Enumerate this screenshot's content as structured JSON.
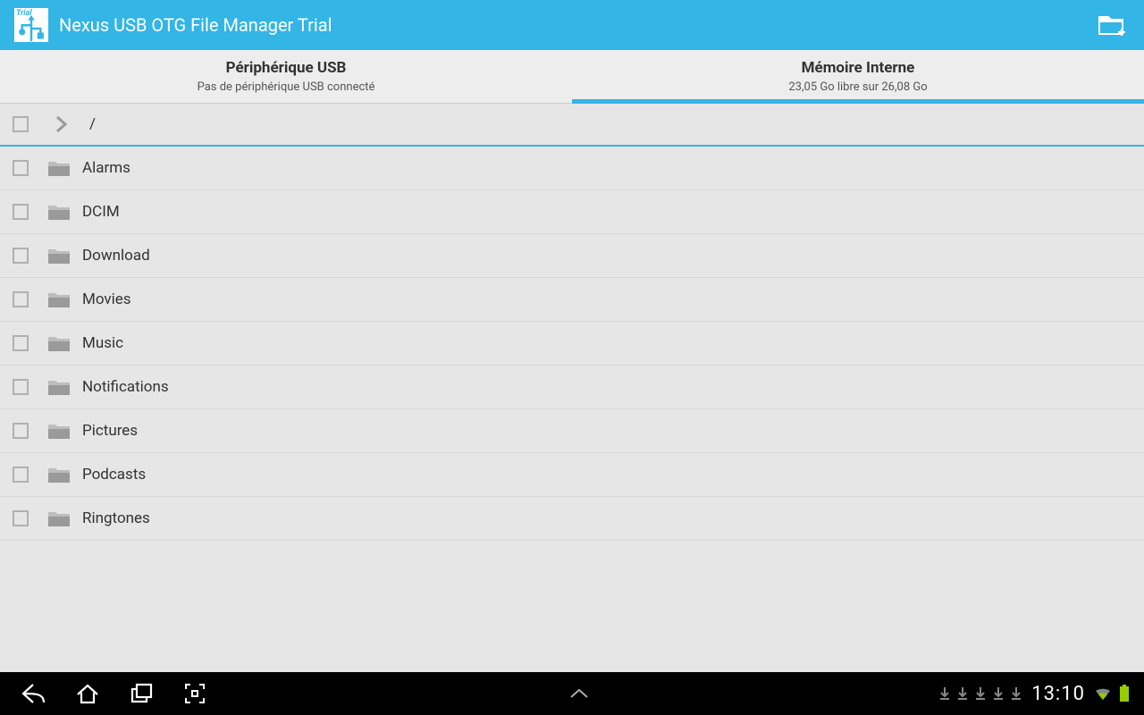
{
  "app": {
    "title": "Nexus USB OTG File Manager Trial",
    "icon_trial": "Trial"
  },
  "tabs": {
    "usb": {
      "title": "Périphérique USB",
      "subtitle": "Pas de périphérique USB connecté"
    },
    "internal": {
      "title": "Mémoire Interne",
      "subtitle": "23,05 Go libre sur 26,08 Go"
    }
  },
  "path": {
    "current": "/"
  },
  "files": [
    {
      "name": "Alarms"
    },
    {
      "name": "DCIM"
    },
    {
      "name": "Download"
    },
    {
      "name": "Movies"
    },
    {
      "name": "Music"
    },
    {
      "name": "Notifications"
    },
    {
      "name": "Pictures"
    },
    {
      "name": "Podcasts"
    },
    {
      "name": "Ringtones"
    }
  ],
  "statusbar": {
    "time": "13:10"
  }
}
